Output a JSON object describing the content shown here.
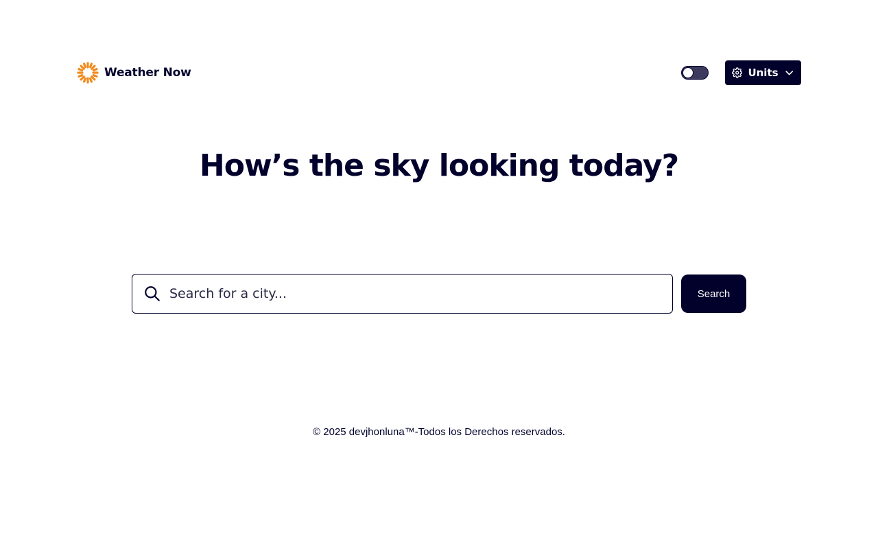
{
  "header": {
    "brand_name": "Weather Now",
    "brand_icon": "sun-logo-icon",
    "theme_toggle": {
      "state": "off"
    },
    "units_button": {
      "label": "Units",
      "icon": "gear-icon",
      "chevron": "chevron-down-icon"
    }
  },
  "hero": {
    "title": "How’s the sky looking today?"
  },
  "search": {
    "icon": "search-icon",
    "placeholder": "Search for a city...",
    "value": "",
    "button_label": "Search"
  },
  "footer": {
    "text": "© 2025 devjhonluna™-Todos los Derechos reservados."
  },
  "colors": {
    "primary": "#02012c",
    "accent": "#f08a1c",
    "background": "#ffffff"
  }
}
